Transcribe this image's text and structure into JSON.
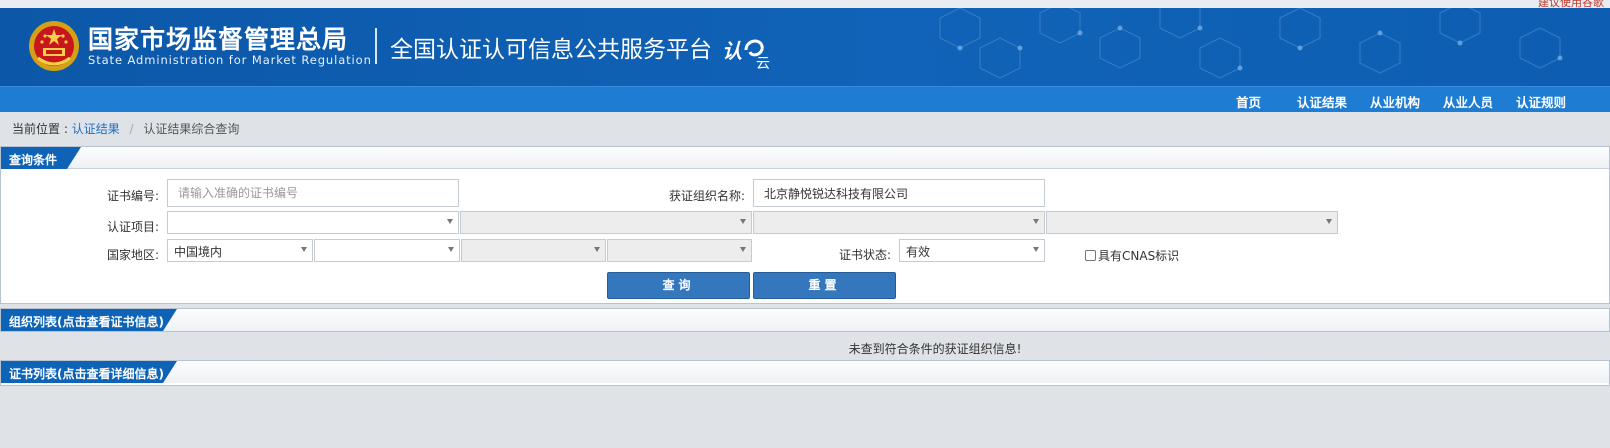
{
  "top_strip": {
    "hint": "建议使用谷歌"
  },
  "header": {
    "agency_name_cn": "国家市场监督管理总局",
    "agency_name_en": "State Administration  for  Market Regulation",
    "platform_title": "全国认证认可信息公共服务平台",
    "brand_logo_text_a": "认",
    "brand_logo_text_b": "云",
    "brand_color": "#0c57a8"
  },
  "nav": {
    "items": [
      {
        "label": "首页"
      },
      {
        "label": "认证结果"
      },
      {
        "label": "从业机构"
      },
      {
        "label": "从业人员"
      },
      {
        "label": "认证规则"
      }
    ]
  },
  "breadcrumb": {
    "prefix": "当前位置 :",
    "parent": "认证结果",
    "separator": "/",
    "current": "认证结果综合查询"
  },
  "query": {
    "panel_title": "查询条件",
    "cert_no_label": "证书编号:",
    "cert_no_placeholder": "请输入准确的证书编号",
    "cert_no_value": "",
    "org_name_label": "获证组织名称:",
    "org_name_value": "北京静悦锐达科技有限公司",
    "project_label": "认证项目:",
    "project_selects": [
      "",
      "",
      "",
      ""
    ],
    "region_label": "国家地区:",
    "region_selects": [
      "中国境内",
      "",
      "",
      ""
    ],
    "status_label": "证书状态:",
    "status_value": "有效",
    "cnas_label": "具有CNAS标识",
    "cnas_checked": false,
    "search_button": "查询",
    "reset_button": "重置"
  },
  "org_list": {
    "panel_title": "组织列表(点击查看证书信息)",
    "empty_message": "未查到符合条件的获证组织信息!"
  },
  "cert_list": {
    "panel_title": "证书列表(点击查看详细信息)"
  },
  "colors": {
    "nav_bar": "#1e7cd2",
    "panel_tab": "#0e63b7",
    "button": "#3577bd",
    "link": "#1f6fc2"
  }
}
